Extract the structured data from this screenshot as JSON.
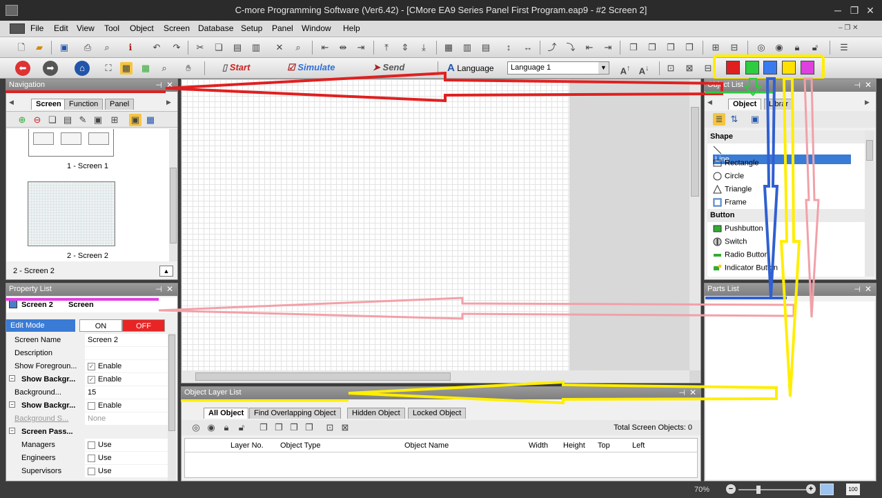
{
  "window": {
    "title": "C-more Programming Software (Ver6.42) - [CMore EA9 Series Panel First Program.eap9 - #2 Screen 2]"
  },
  "menu": [
    "File",
    "Edit",
    "View",
    "Tool",
    "Object",
    "Screen",
    "Database",
    "Setup",
    "Panel",
    "Window",
    "Help"
  ],
  "toolbar2": {
    "start": "Start",
    "simulate": "Simulate",
    "send": "Send",
    "language_label": "Language",
    "language_value": "Language 1"
  },
  "colors": {
    "red": "#e02020",
    "green": "#2ecc40",
    "blue": "#3a7bf0",
    "yellow": "#ffe000",
    "magenta": "#e040e0",
    "highlight_yellow": "#ffee00",
    "arrow_red": "#e02020",
    "arrow_pink": "#f2a0a8",
    "arrow_blue": "#3060d0",
    "arrow_yellow": "#ffee00"
  },
  "navigation": {
    "title": "Navigation",
    "tabs": [
      "Screen",
      "Function",
      "Panel"
    ],
    "thumbs": [
      {
        "label": "1 - Screen 1"
      },
      {
        "label": "2 - Screen 2"
      }
    ],
    "footer": "2 - Screen 2"
  },
  "property": {
    "title": "Property List",
    "object": "Screen 2",
    "type": "Screen",
    "edit_mode": "Edit Mode",
    "on": "ON",
    "off": "OFF",
    "rows": [
      {
        "k": "Screen Name",
        "v": "Screen 2"
      },
      {
        "k": "Description",
        "v": ""
      },
      {
        "k": "Show Foregroun...",
        "v": "Enable"
      },
      {
        "k": "Show Backgr...",
        "v": "Enable"
      },
      {
        "k": "Background...",
        "v": "15"
      },
      {
        "k": "Show Backgr...",
        "v": "Enable"
      },
      {
        "k": "Background S...",
        "v": "None"
      },
      {
        "k": "Screen Pass...",
        "v": ""
      },
      {
        "k": "Managers",
        "v": "Use"
      },
      {
        "k": "Engineers",
        "v": "Use"
      },
      {
        "k": "Supervisors",
        "v": "Use"
      }
    ]
  },
  "object_list": {
    "title": "Object List",
    "tabs": [
      "Object",
      "Librar"
    ],
    "groups": [
      {
        "name": "Shape",
        "items": [
          "Line",
          "Rectangle",
          "Circle",
          "Triangle",
          "Frame"
        ]
      },
      {
        "name": "Button",
        "items": [
          "Pushbutton",
          "Switch",
          "Radio Button",
          "Indicator Button"
        ]
      }
    ]
  },
  "parts_list": {
    "title": "Parts List"
  },
  "layer_list": {
    "title": "Object Layer List",
    "tabs": [
      "All Object",
      "Find Overlapping Object",
      "Hidden Object",
      "Locked Object"
    ],
    "total": "Total Screen Objects: 0",
    "columns": [
      "Layer No.",
      "Object Type",
      "Object Name",
      "Width",
      "Height",
      "Top",
      "Left"
    ]
  },
  "status": {
    "zoom": "70%"
  }
}
